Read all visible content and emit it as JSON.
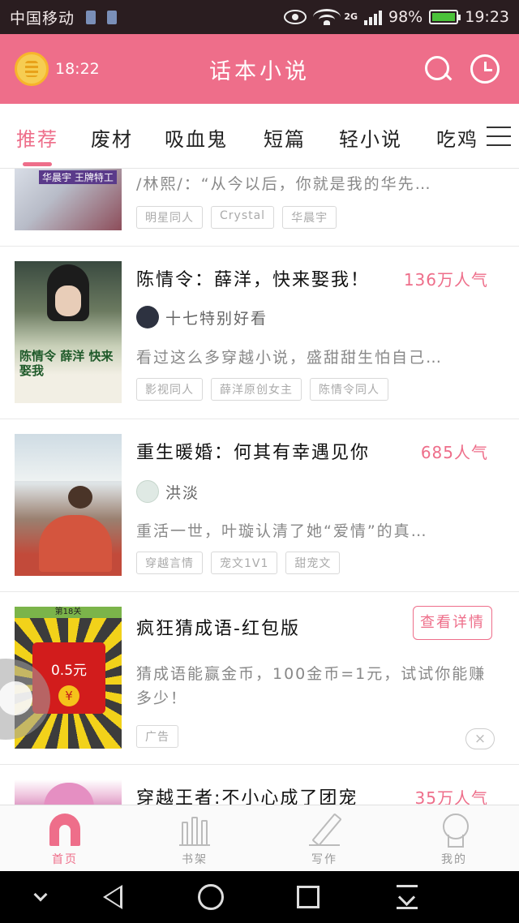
{
  "status_bar": {
    "carrier": "中国移动",
    "network": "2G",
    "battery": "98%",
    "time": "19:23"
  },
  "header": {
    "alarm_time": "18:22",
    "title": "话本小说",
    "icons": [
      "alarm-icon",
      "search-icon",
      "history-clock-icon",
      "menu-icon"
    ]
  },
  "tabs": [
    {
      "label": "推荐",
      "active": true
    },
    {
      "label": "废材"
    },
    {
      "label": "吸血鬼"
    },
    {
      "label": "短篇"
    },
    {
      "label": "轻小说"
    },
    {
      "label": "吃鸡"
    }
  ],
  "books": [
    {
      "description": "/林熙/：“从今以后，你就是我的华先…",
      "tags": [
        "明星同人",
        "Crystal",
        "华晨宇"
      ],
      "cover_text": "华晨宇 王牌特工"
    },
    {
      "title": "陈情令：薛洋，快来娶我！",
      "popularity": "136万人气",
      "author": "十七特别好看",
      "description": "看过这么多穿越小说，盛甜甜生怕自己…",
      "tags": [
        "影视同人",
        "薛洋原创女主",
        "陈情令同人"
      ],
      "cover_text": "陈情令 薛洋 快来娶我"
    },
    {
      "title": "重生暖婚：何其有幸遇见你",
      "popularity": "685人气",
      "author": "洪淡",
      "description": "重活一世，叶璇认清了她“爱情”的真…",
      "tags": [
        "穿越言情",
        "宠文1V1",
        "甜宠文"
      ]
    }
  ],
  "ad": {
    "title": "疯狂猜成语-红包版",
    "button": "查看详情",
    "description": "猜成语能赢金币，100金币=1元，试试你能赚多少！",
    "tag": "广告",
    "close": "×",
    "cover_amount": "0.5元",
    "cover_level": "第18关",
    "cover_symbol": "¥"
  },
  "peek_book": {
    "title": "穿越王者:不小心成了团宠",
    "popularity": "35万人气"
  },
  "bottom_nav": [
    {
      "label": "首页",
      "icon": "home-icon",
      "active": true
    },
    {
      "label": "书架",
      "icon": "bookshelf-icon"
    },
    {
      "label": "写作",
      "icon": "pen-icon"
    },
    {
      "label": "我的",
      "icon": "profile-icon"
    }
  ],
  "colors": {
    "accent": "#ee6e8a",
    "status_bar": "#2a1d20",
    "battery": "#4bc23a"
  }
}
